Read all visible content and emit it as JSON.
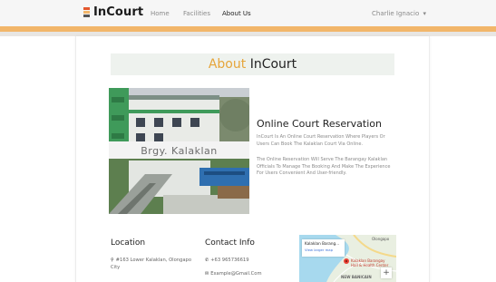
{
  "navbar": {
    "brand": "InCourt",
    "links": [
      "Home",
      "Facilities",
      "About Us"
    ],
    "active_link": "About Us",
    "user": "Charlie Ignacio",
    "caret": "▾"
  },
  "colors": {
    "accent_orange": "#f2b66a",
    "title_accent": "#e6a53a",
    "banner_bg": "#eef2ee"
  },
  "about": {
    "accent_word": "About",
    "rest": "InCourt"
  },
  "photo": {
    "caption": "Brgy. Kalaklan"
  },
  "reservation": {
    "title": "Online Court Reservation",
    "p1_line1": "InCourt Is An Online Court Reservation Where Players Or",
    "p1_line2": "Users Can Book The Kalaklan Court Via Online.",
    "p2_line1": "The Online Reservation Will Serve The Barangay Kalaklan",
    "p2_line2": "Officials To Manage The Booking And Make The Experience",
    "p2_line3": "For Users Convenient And User-friendly."
  },
  "location": {
    "title": "Location",
    "icon": "map-marker-icon",
    "address_line1": "#163 Lower Kalaklan, Olongapo",
    "address_line2": "City"
  },
  "contact": {
    "title": "Contact Info",
    "phone_icon": "phone-icon",
    "phone": "+63 965736619",
    "email_icon": "envelope-icon",
    "email": "Example@Gmail.Com"
  },
  "map": {
    "popup_title": "Kalaklan Barang...",
    "popup_link": "View larger map",
    "city_label": "Olongapo",
    "marker_label_line1": "Kalaklan Barangay",
    "marker_label_line2": "Hall & Health Center",
    "area_label": "NEW BANICAIN",
    "zoom_in": "+"
  }
}
